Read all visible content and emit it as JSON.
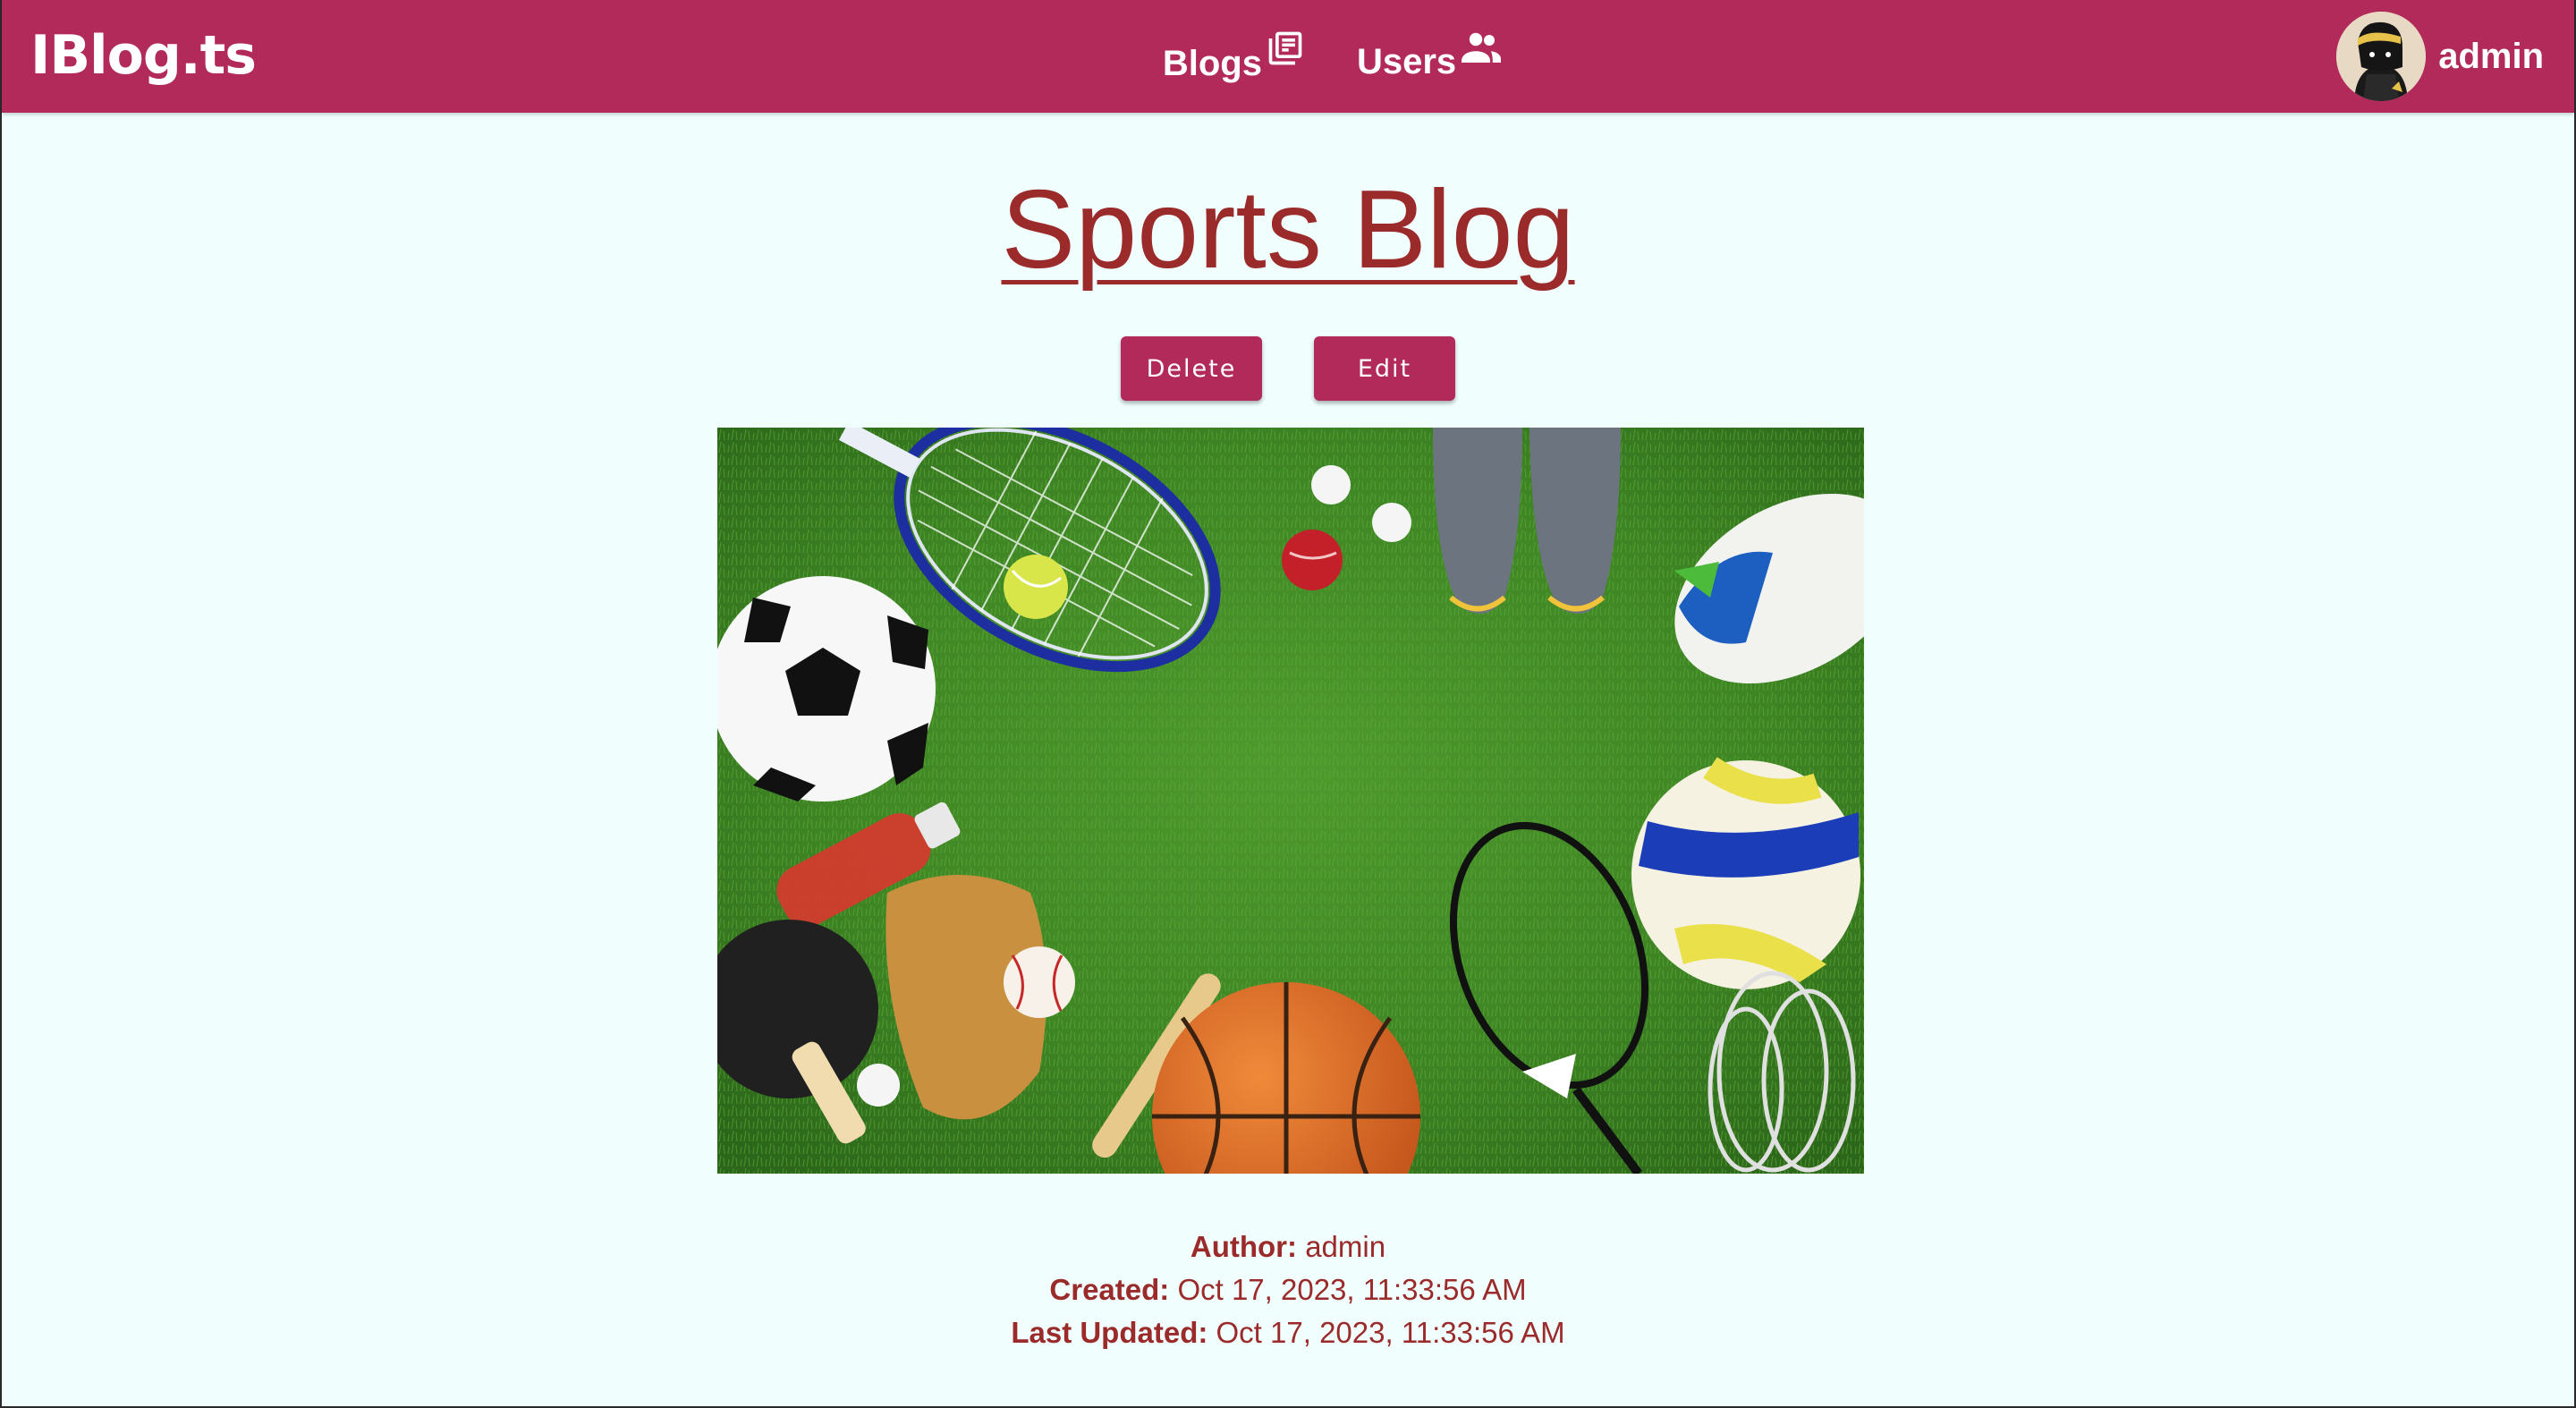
{
  "app": {
    "logo": "IBlog.ts"
  },
  "nav": {
    "blogs_label": "Blogs",
    "blogs_icon": "newspaper-icon",
    "users_label": "Users",
    "users_icon": "people-icon"
  },
  "user": {
    "name": "admin"
  },
  "post": {
    "title": "Sports Blog",
    "delete_label": "Delete",
    "edit_label": "Edit",
    "image_description": "sports equipment on grass",
    "author_label": "Author:",
    "author": "admin",
    "created_label": "Created:",
    "created": "Oct 17, 2023, 11:33:56 AM",
    "updated_label": "Last Updated:",
    "updated": "Oct 17, 2023, 11:33:56 AM"
  },
  "colors": {
    "brand": "#b22a5a",
    "title": "#9b2a2a",
    "background": "#f0fffe"
  }
}
